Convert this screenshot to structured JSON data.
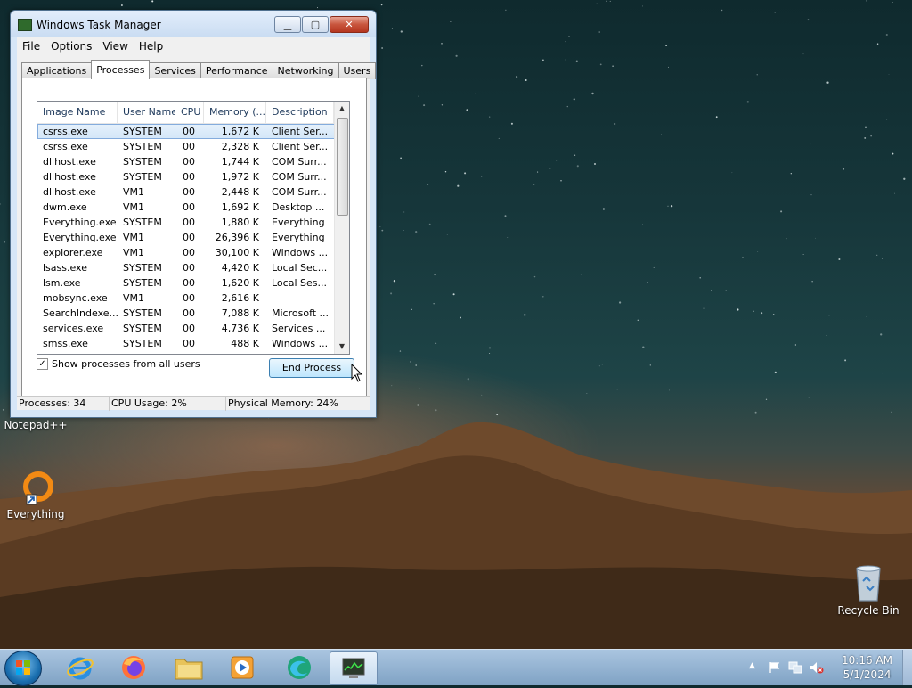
{
  "desktop": {
    "icons": [
      {
        "label": "Notepad++"
      },
      {
        "label": "Everything"
      },
      {
        "label": "Recycle Bin"
      }
    ]
  },
  "window": {
    "title": "Windows Task Manager",
    "menu": [
      "File",
      "Options",
      "View",
      "Help"
    ],
    "tabs": [
      "Applications",
      "Processes",
      "Services",
      "Performance",
      "Networking",
      "Users"
    ],
    "active_tab": "Processes",
    "columns": [
      "Image Name",
      "User Name",
      "CPU",
      "Memory (...",
      "Description"
    ],
    "processes": [
      {
        "image": "csrss.exe",
        "user": "SYSTEM",
        "cpu": "00",
        "memory": "1,672 K",
        "desc": "Client Ser..."
      },
      {
        "image": "csrss.exe",
        "user": "SYSTEM",
        "cpu": "00",
        "memory": "2,328 K",
        "desc": "Client Ser..."
      },
      {
        "image": "dllhost.exe",
        "user": "SYSTEM",
        "cpu": "00",
        "memory": "1,744 K",
        "desc": "COM Surr..."
      },
      {
        "image": "dllhost.exe",
        "user": "SYSTEM",
        "cpu": "00",
        "memory": "1,972 K",
        "desc": "COM Surr..."
      },
      {
        "image": "dllhost.exe",
        "user": "VM1",
        "cpu": "00",
        "memory": "2,448 K",
        "desc": "COM Surr..."
      },
      {
        "image": "dwm.exe",
        "user": "VM1",
        "cpu": "00",
        "memory": "1,692 K",
        "desc": "Desktop ..."
      },
      {
        "image": "Everything.exe",
        "user": "SYSTEM",
        "cpu": "00",
        "memory": "1,880 K",
        "desc": "Everything"
      },
      {
        "image": "Everything.exe",
        "user": "VM1",
        "cpu": "00",
        "memory": "26,396 K",
        "desc": "Everything"
      },
      {
        "image": "explorer.exe",
        "user": "VM1",
        "cpu": "00",
        "memory": "30,100 K",
        "desc": "Windows ..."
      },
      {
        "image": "lsass.exe",
        "user": "SYSTEM",
        "cpu": "00",
        "memory": "4,420 K",
        "desc": "Local Sec..."
      },
      {
        "image": "lsm.exe",
        "user": "SYSTEM",
        "cpu": "00",
        "memory": "1,620 K",
        "desc": "Local Ses..."
      },
      {
        "image": "mobsync.exe",
        "user": "VM1",
        "cpu": "00",
        "memory": "2,616 K",
        "desc": ""
      },
      {
        "image": "SearchIndexe...",
        "user": "SYSTEM",
        "cpu": "00",
        "memory": "7,088 K",
        "desc": "Microsoft ..."
      },
      {
        "image": "services.exe",
        "user": "SYSTEM",
        "cpu": "00",
        "memory": "4,736 K",
        "desc": "Services ..."
      },
      {
        "image": "smss.exe",
        "user": "SYSTEM",
        "cpu": "00",
        "memory": "488 K",
        "desc": "Windows ..."
      }
    ],
    "show_all_label": "Show processes from all users",
    "show_all_checked": true,
    "end_process_label": "End Process",
    "status": {
      "processes": "Processes: 34",
      "cpu": "CPU Usage: 2%",
      "memory": "Physical Memory: 24%"
    }
  },
  "taskbar": {
    "apps": [
      "start-orb",
      "internet-explorer",
      "firefox",
      "windows-explorer",
      "media-player",
      "edge",
      "task-manager"
    ],
    "clock_time": "10:16 AM",
    "clock_date": "5/1/2024"
  },
  "colors": {
    "selection": "#d3e6f8",
    "taskbar": "#8fb0d0",
    "close_button": "#c8553d"
  }
}
